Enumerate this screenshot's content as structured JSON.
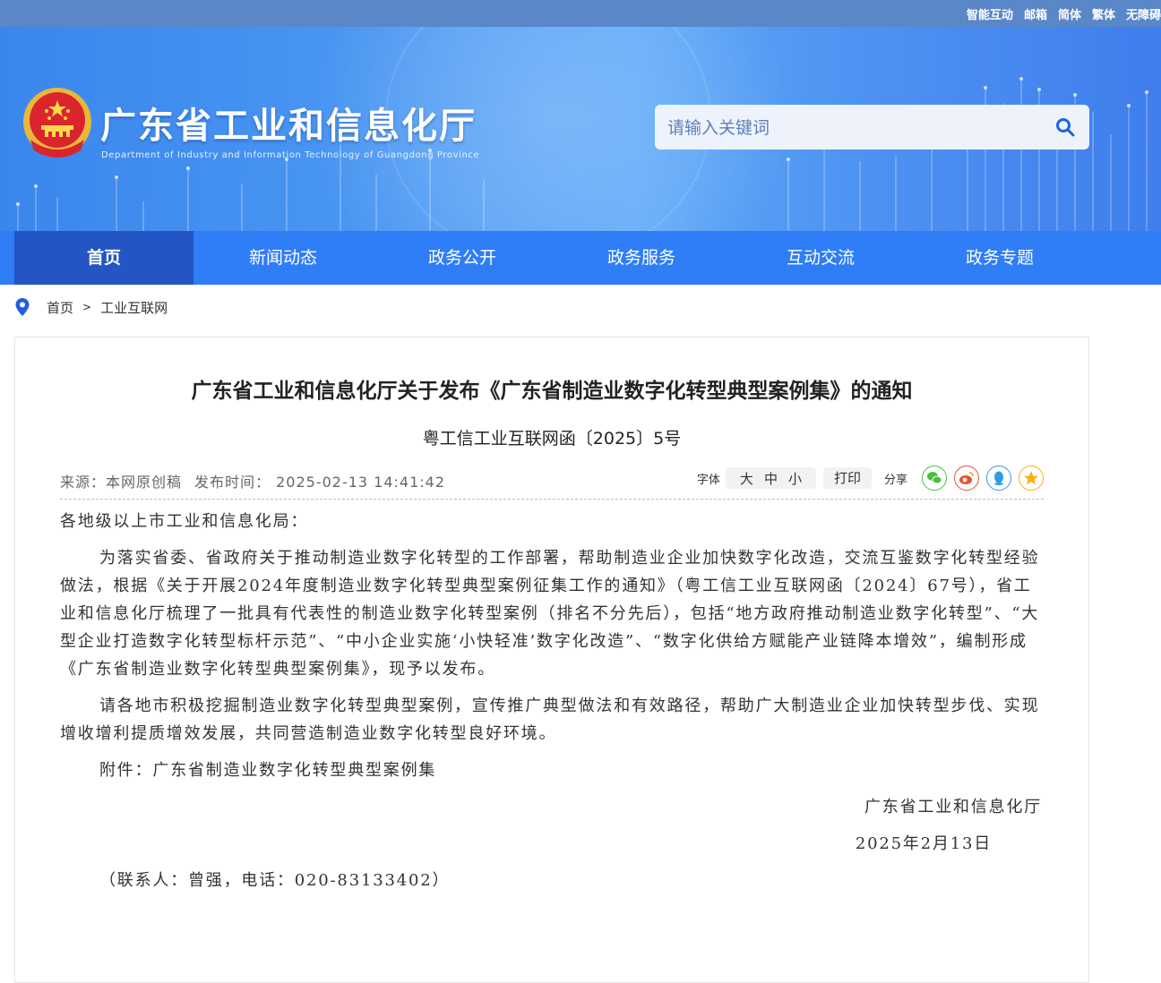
{
  "top_links": [
    "智能互动",
    "邮箱",
    "简体",
    "繁体",
    "无障碍"
  ],
  "header": {
    "title": "广东省工业和信息化厅",
    "subtitle": "Department of Industry and Information Technology of Guangdong Province",
    "search_placeholder": "请输入关键词",
    "search_icon": "search-icon",
    "emblem": "national-emblem"
  },
  "nav": [
    {
      "label": "首页",
      "active": true
    },
    {
      "label": "新闻动态",
      "active": false
    },
    {
      "label": "政务公开",
      "active": false
    },
    {
      "label": "政务服务",
      "active": false
    },
    {
      "label": "互动交流",
      "active": false
    },
    {
      "label": "政务专题",
      "active": false
    }
  ],
  "breadcrumb": {
    "icon": "location-pin-icon",
    "items": [
      "首页",
      "工业互联网"
    ],
    "separator": ">"
  },
  "article": {
    "title": "广东省工业和信息化厅关于发布《广东省制造业数字化转型典型案例集》的通知",
    "doc_no": "粤工信工业互联网函〔2025〕5号",
    "source": "来源：本网原创稿",
    "publish_time": "发布时间：  2025-02-13 14:41:42",
    "font_label": "字体",
    "font_sizes": [
      "大",
      "中",
      "小"
    ],
    "print_label": "打印",
    "share_label": "分享",
    "share_icons": [
      "wechat-icon",
      "weibo-icon",
      "qq-icon",
      "qzone-icon"
    ],
    "salutation": "各地级以上市工业和信息化局：",
    "paragraph1": "为落实省委、省政府关于推动制造业数字化转型的工作部署，帮助制造业企业加快数字化改造，交流互鉴数字化转型经验做法，根据《关于开展2024年度制造业数字化转型典型案例征集工作的通知》（粤工信工业互联网函〔2024〕67号），省工业和信息化厅梳理了一批具有代表性的制造业数字化转型案例（排名不分先后），包括“地方政府推动制造业数字化转型”、“大型企业打造数字化转型标杆示范”、“中小企业实施‘小快轻准’数字化改造”、“数字化供给方赋能产业链降本增效”，编制形成《广东省制造业数字化转型典型案例集》，现予以发布。",
    "paragraph2": "请各地市积极挖掘制造业数字化转型典型案例，宣传推广典型做法和有效路径，帮助广大制造业企业加快转型步伐、实现增收增利提质增效发展，共同营造制造业数字化转型良好环境。",
    "attachment": "附件：广东省制造业数字化转型典型案例集",
    "signature_org": "广东省工业和信息化厅",
    "signature_date": "2025年2月13日",
    "contact": "（联系人：曾强，电话：020-83133402）"
  },
  "colors": {
    "nav_bg": "#2f7df7",
    "nav_active": "#2355c4",
    "banner": "#4b98f3"
  }
}
